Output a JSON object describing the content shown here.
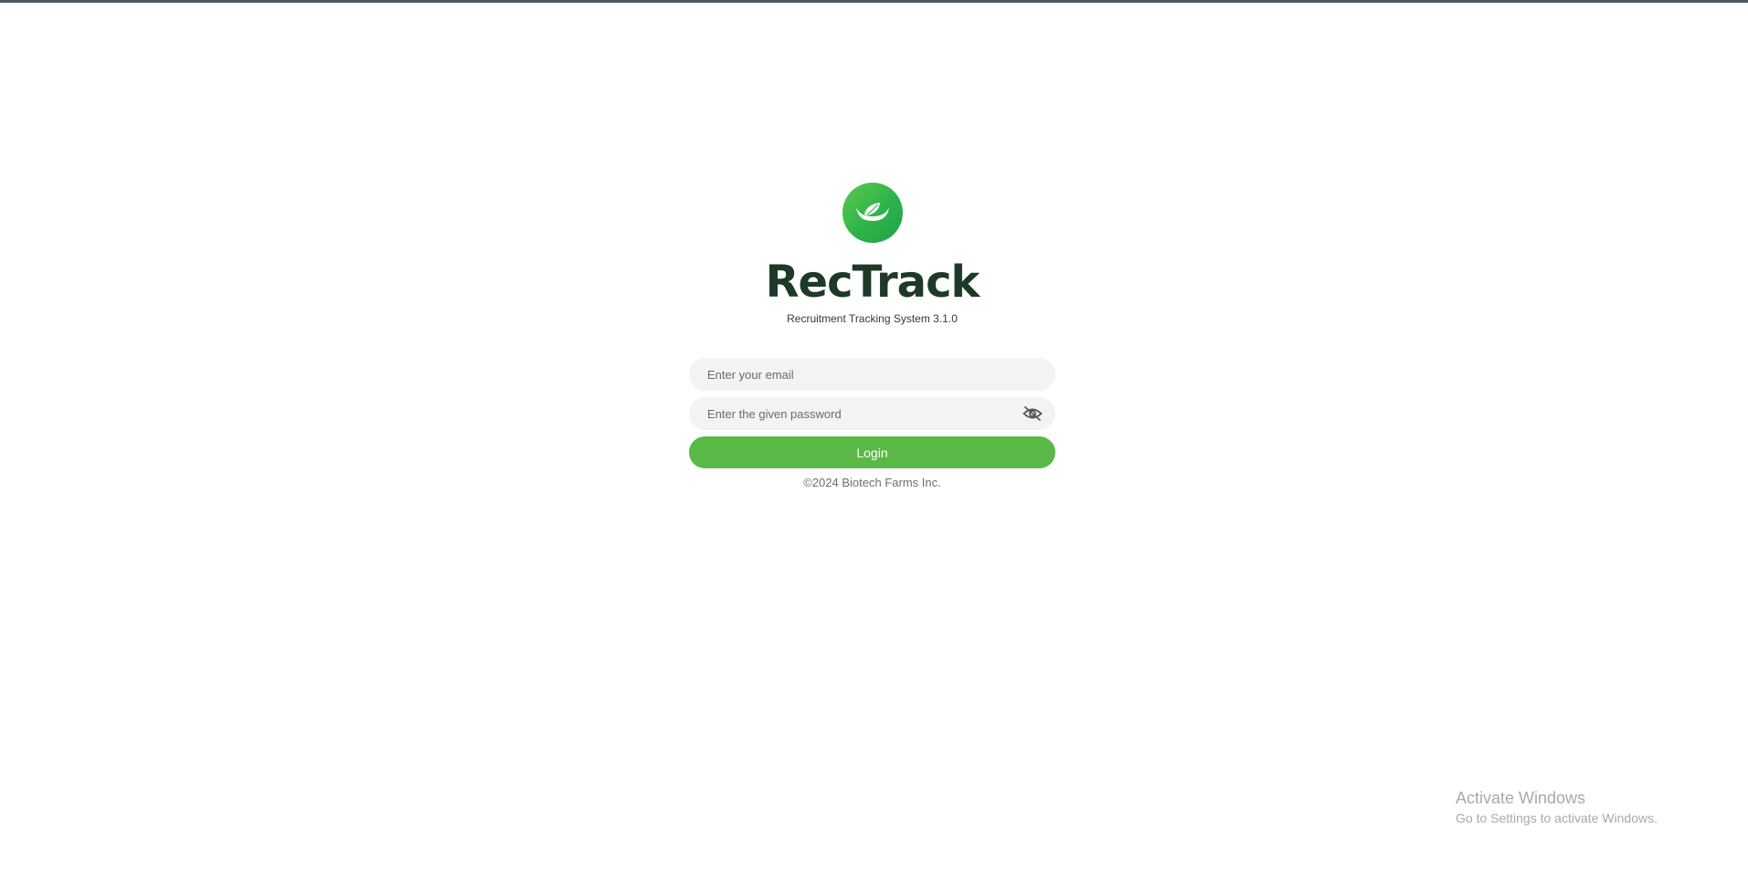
{
  "app": {
    "title": "RecTrack",
    "subtitle": "Recruitment Tracking System 3.1.0",
    "logo_icon": "leaf-logo-icon"
  },
  "login_form": {
    "email_placeholder": "Enter your email",
    "email_value": "",
    "password_placeholder": "Enter the given password",
    "password_value": "",
    "password_toggle_icon": "eye-slash-icon",
    "login_label": "Login"
  },
  "footer": {
    "copyright": "©2024 Biotech Farms Inc."
  },
  "windows_watermark": {
    "title": "Activate Windows",
    "subtitle": "Go to Settings to activate Windows."
  },
  "colors": {
    "brand_green": "#5ab946",
    "title_dark_green": "#1d3a26",
    "input_background": "#f3f3f3"
  }
}
